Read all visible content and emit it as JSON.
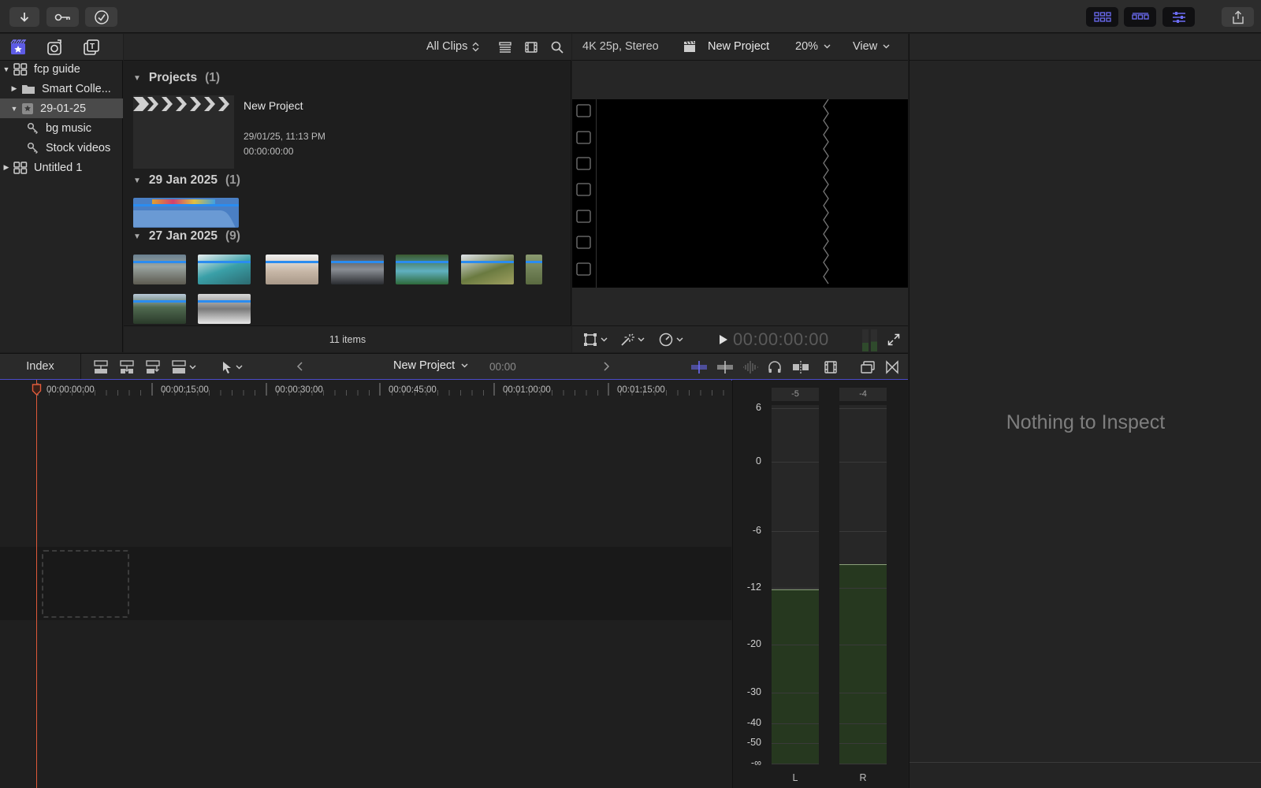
{
  "toolbar": {
    "left_icons": [
      "import-icon",
      "keyword-icon",
      "checkmark-icon"
    ],
    "right_icons": [
      "browser-toggle-icon",
      "timeline-toggle-icon",
      "inspector-toggle-icon",
      "share-icon"
    ],
    "accent": "#5e5ce6"
  },
  "sidebar": {
    "tabs": [
      "libraries-icon",
      "photos-audio-icon",
      "titles-generators-icon"
    ],
    "items": [
      {
        "label": "fcp guide",
        "level": 0,
        "expanded": true,
        "icon": "library-icon"
      },
      {
        "label": "Smart Colle...",
        "level": 1,
        "expanded": false,
        "icon": "folder-icon"
      },
      {
        "label": "29-01-25",
        "level": 1,
        "expanded": true,
        "icon": "event-icon",
        "selected": true
      },
      {
        "label": "bg music",
        "level": 2,
        "icon": "keyword-collection-icon"
      },
      {
        "label": "Stock videos",
        "level": 2,
        "icon": "keyword-collection-icon"
      },
      {
        "label": "Untitled 1",
        "level": 0,
        "expanded": false,
        "icon": "library-icon"
      }
    ]
  },
  "browser": {
    "filter": "All Clips",
    "sections": [
      {
        "title": "Projects",
        "count": "(1)"
      },
      {
        "title": "29 Jan 2025",
        "count": "(1)"
      },
      {
        "title": "27 Jan 2025",
        "count": "(9)"
      }
    ],
    "project": {
      "name": "New Project",
      "date": "29/01/25, 11:13 PM",
      "duration": "00:00:00:00"
    },
    "footer": "11 items"
  },
  "viewer": {
    "format": "4K 25p, Stereo",
    "project": "New Project",
    "zoom": "20%",
    "view_label": "View",
    "timecode": "00:00:00:00"
  },
  "timeline": {
    "index_label": "Index",
    "project": "New Project",
    "duration": "00:00",
    "ruler": [
      "00:00:00:00",
      "00:00:15:00",
      "00:00:30:00",
      "00:00:45:00",
      "00:01:00:00",
      "00:01:15:00"
    ]
  },
  "meters": {
    "peaks": [
      "-5",
      "-4"
    ],
    "scale": [
      "6",
      "0",
      "-6",
      "-12",
      "-20",
      "-30",
      "-40",
      "-50",
      "-∞"
    ],
    "channels": [
      "L",
      "R"
    ],
    "levels_db": {
      "L": -12.2,
      "R": -9.5
    }
  },
  "inspector": {
    "empty": "Nothing to Inspect"
  }
}
